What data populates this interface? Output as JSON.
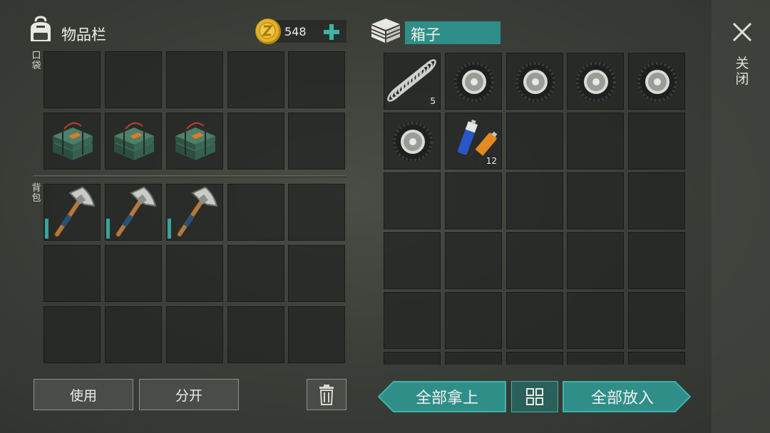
{
  "inventory": {
    "title": "物品栏",
    "pocket_label": "口袋",
    "backpack_label": "背包",
    "coins": "548",
    "add_icon": "plus-icon",
    "backpack_icon": "backpack-icon"
  },
  "container": {
    "title": "箱子",
    "icon": "crate-icon",
    "items": [
      {
        "name": "spring",
        "count": "5"
      },
      {
        "name": "wheel"
      },
      {
        "name": "wheel"
      },
      {
        "name": "wheel"
      },
      {
        "name": "wheel"
      },
      {
        "name": "wheel"
      },
      {
        "name": "batteries",
        "count": "12"
      }
    ]
  },
  "pocket_items": [
    "explosive-pack",
    "explosive-pack",
    "explosive-pack"
  ],
  "backpack_items": [
    "pickaxe",
    "pickaxe",
    "pickaxe"
  ],
  "close": {
    "label": "关闭",
    "icon": "close-icon"
  },
  "buttons": {
    "use": "使用",
    "split": "分开",
    "take_all": "全部拿上",
    "put_all": "全部放入",
    "trash_icon": "trash-icon",
    "sort_icon": "sort-icon"
  },
  "colors": {
    "teal": "#2f8f88",
    "teal_light": "#3fb3a8",
    "gold": "#e2b32c"
  }
}
